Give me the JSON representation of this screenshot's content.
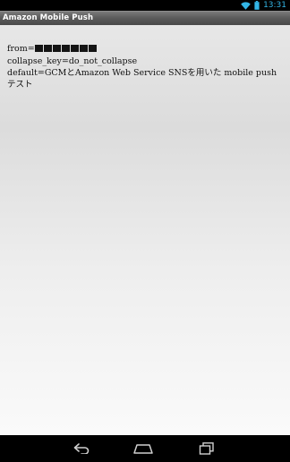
{
  "status_bar": {
    "time": "13:31",
    "icons": [
      "wifi-icon",
      "battery-icon"
    ],
    "accent_color": "#33b5e5"
  },
  "app": {
    "title": "Amazon Mobile Push"
  },
  "message": {
    "from_label": "from=",
    "collapse_key_line": "collapse_key=do_not_collapse",
    "default_line": "default=GCMとAmazon Web Service SNSを用いた mobile push テスト"
  },
  "nav_bar": {
    "icons": [
      "back-icon",
      "home-icon",
      "recent-apps-icon"
    ]
  }
}
